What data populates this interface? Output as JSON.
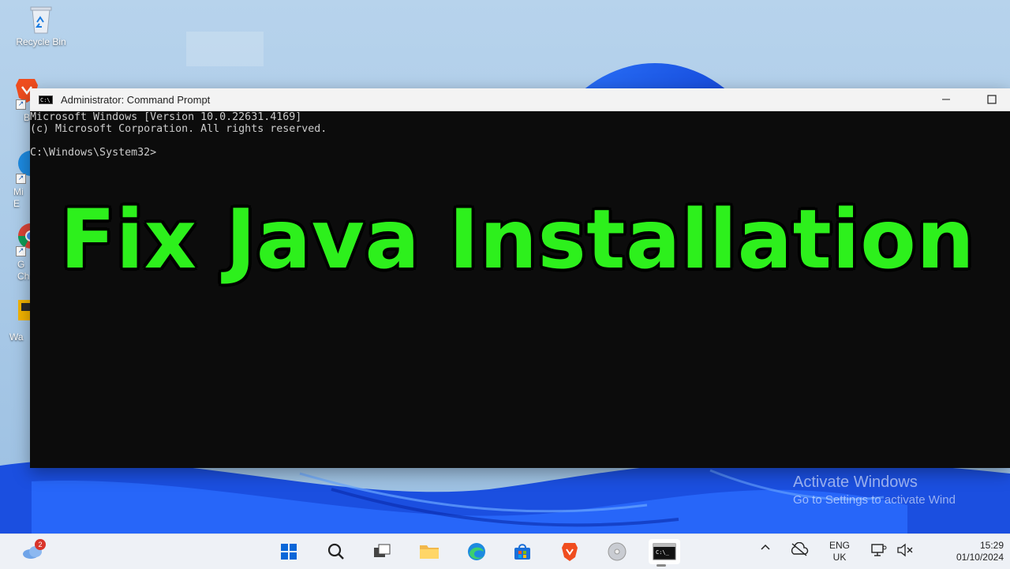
{
  "desktop": {
    "icons": [
      {
        "label": "Recycle Bin"
      },
      {
        "label": "B"
      },
      {
        "label": "Mi\nE"
      },
      {
        "label": "G\nCh"
      },
      {
        "label": "Wa"
      }
    ]
  },
  "window": {
    "title": "Administrator: Command Prompt",
    "minimize_glyph": "—",
    "maximize_glyph": "☐",
    "terminal_lines": [
      "Microsoft Windows [Version 10.0.22631.4169]",
      "(c) Microsoft Corporation. All rights reserved.",
      "",
      "C:\\Windows\\System32>"
    ]
  },
  "overlay": {
    "headline": "Fix Java Installation",
    "headline_color": "#2df01c"
  },
  "watermark": {
    "line1": "Activate Windows",
    "line2": "Go to Settings to activate Wind"
  },
  "taskbar": {
    "weather_badge": "2",
    "apps": [
      "start-icon",
      "search-icon",
      "task-view-icon",
      "file-explorer-icon",
      "edge-icon",
      "store-icon",
      "brave-icon",
      "disc-icon",
      "command-prompt-icon"
    ],
    "tray": {
      "chevron": "^",
      "lang_line1": "ENG",
      "lang_line2": "UK",
      "time": "15:29",
      "date": "01/10/2024"
    }
  },
  "colors": {
    "terminal_bg": "#0c0c0c",
    "terminal_fg": "#cccccc",
    "accent_blue": "#1e4fd6"
  }
}
